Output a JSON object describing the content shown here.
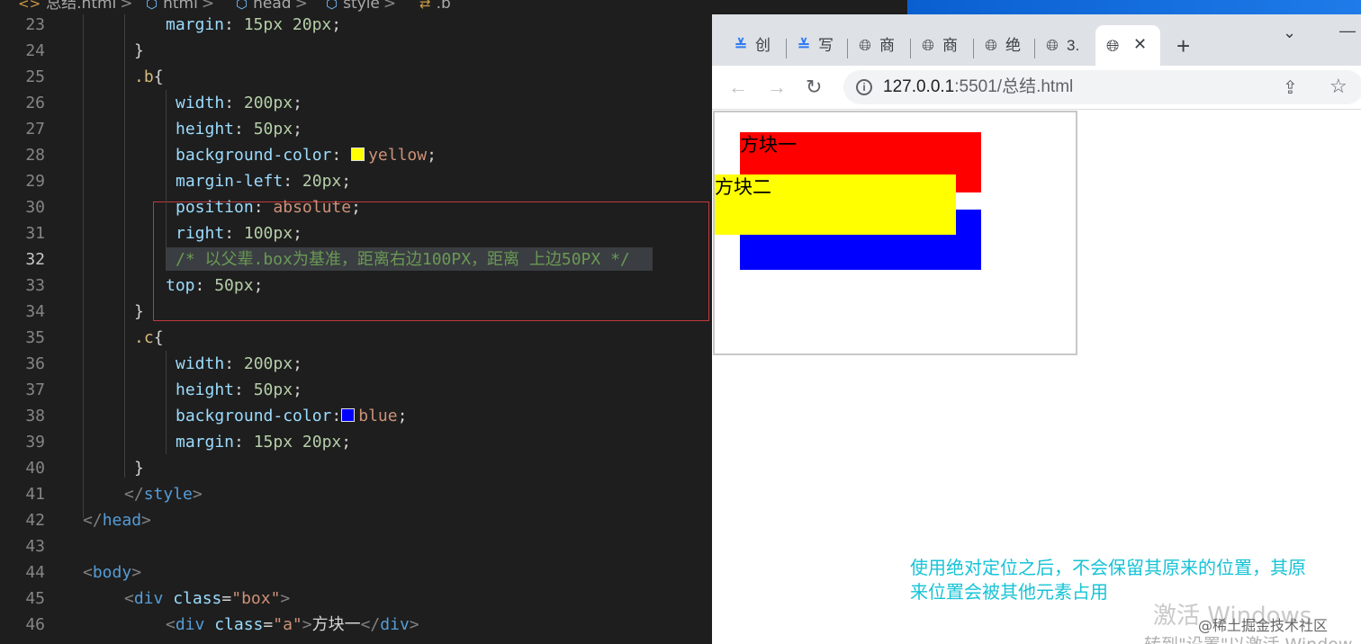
{
  "breadcrumbs": {
    "file": "总结.html",
    "html": "html",
    "head": "head",
    "style": "style",
    "rule": ".b"
  },
  "lines": [
    {
      "no": "23"
    },
    {
      "no": "24"
    },
    {
      "no": "25"
    },
    {
      "no": "26"
    },
    {
      "no": "27"
    },
    {
      "no": "28"
    },
    {
      "no": "29"
    },
    {
      "no": "30"
    },
    {
      "no": "31"
    },
    {
      "no": "32"
    },
    {
      "no": "33"
    },
    {
      "no": "34"
    },
    {
      "no": "35"
    },
    {
      "no": "36"
    },
    {
      "no": "37"
    },
    {
      "no": "38"
    },
    {
      "no": "39"
    },
    {
      "no": "40"
    },
    {
      "no": "41"
    },
    {
      "no": "42"
    },
    {
      "no": "43"
    },
    {
      "no": "44"
    },
    {
      "no": "45"
    },
    {
      "no": "46"
    }
  ],
  "code": {
    "l23": {
      "prop": "margin",
      "val": "15px 20px"
    },
    "l24": {
      "text": "}"
    },
    "l25": {
      "sel": ".b",
      "brace": "{"
    },
    "l26": {
      "prop": "width",
      "val": "200px"
    },
    "l27": {
      "prop": "height",
      "val": "50px"
    },
    "l28": {
      "prop": "background-color",
      "val": "yellow",
      "swatch": "#ffff00"
    },
    "l29": {
      "prop": "margin-left",
      "val": "20px"
    },
    "l30": {
      "prop": "position",
      "val": "absolute"
    },
    "l31": {
      "prop": "right",
      "val": "100px"
    },
    "l32": {
      "comment": "/* 以父辈.box为基准，距离右边100PX，距离 上边50PX */"
    },
    "l33": {
      "prop": "top",
      "val": "50px"
    },
    "l34": {
      "text": "}"
    },
    "l35": {
      "sel": ".c",
      "brace": "{"
    },
    "l36": {
      "prop": "width",
      "val": "200px"
    },
    "l37": {
      "prop": "height",
      "val": "50px"
    },
    "l38": {
      "prop": "background-color",
      "val": "blue",
      "swatch": "#0000ff"
    },
    "l39": {
      "prop": "margin",
      "val": "15px 20px"
    },
    "l40": {
      "text": "}"
    },
    "l41": {
      "tag": "style"
    },
    "l42": {
      "tag": "head"
    },
    "l44": {
      "tag": "body"
    },
    "l45": {
      "tag": "div",
      "attr": "class",
      "str": "\"box\""
    },
    "l46": {
      "tag": "div",
      "attr": "class",
      "str": "\"a\"",
      "text": "方块一"
    }
  },
  "browser": {
    "tabs": [
      {
        "label": "创",
        "icon": "csdn-icon"
      },
      {
        "label": "写",
        "icon": "csdn-icon"
      },
      {
        "label": "商",
        "icon": "globe-icon"
      },
      {
        "label": "商",
        "icon": "globe-icon"
      },
      {
        "label": "绝",
        "icon": "globe-icon"
      },
      {
        "label": "3.",
        "icon": "globe-icon"
      }
    ],
    "url_host": "127.0.0.1",
    "url_rest": ":5501/总结.html",
    "info_glyph": "i"
  },
  "page": {
    "block_a": "方块一",
    "block_b": "方块二",
    "block_colors": {
      "a": "#ff0000",
      "b": "#ffff00",
      "c": "#0000ff"
    },
    "note_line1": "使用绝对定位之后，不会保留其原来的位置，其原",
    "note_line2": "来位置会被其他元素占用",
    "watermark_line1": "激活 Windows",
    "watermark_line2": "转到\"设置\"以激活 Window",
    "credit": "@稀土掘金技术社区"
  }
}
